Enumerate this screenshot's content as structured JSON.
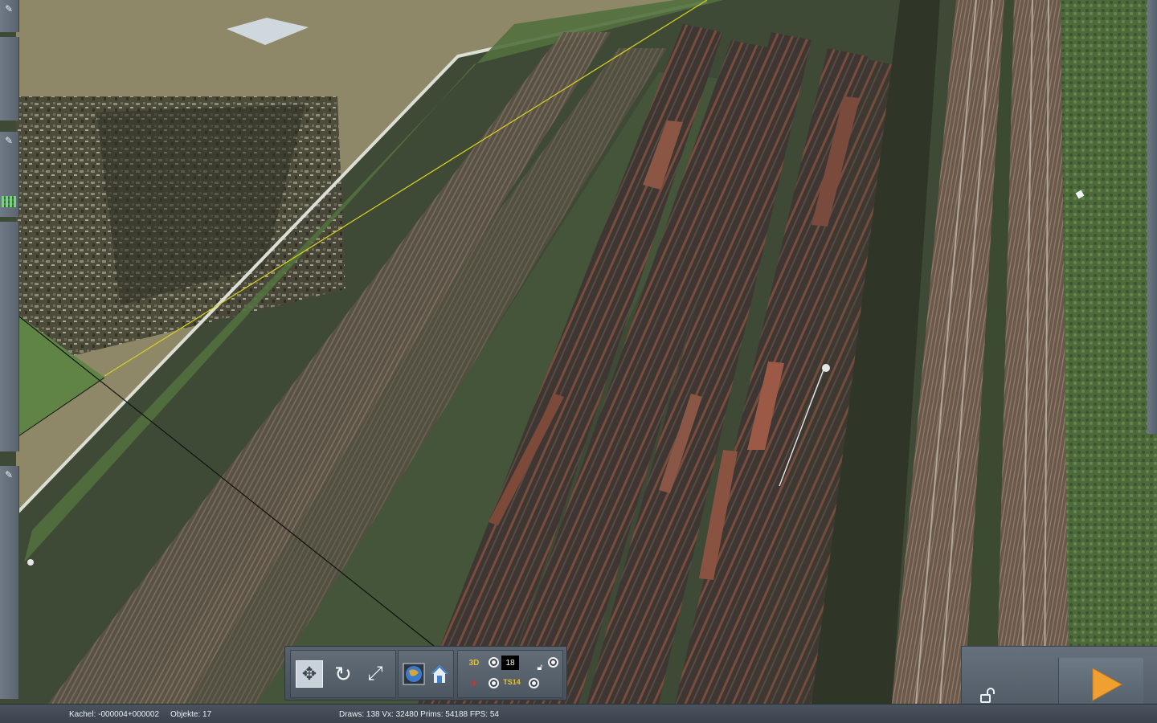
{
  "scene": {
    "description_free": true,
    "colors": {
      "ground_light": "#8f8a6a",
      "scrap_dark": "#3e4032",
      "grass": "#5c7a48",
      "track_bed": "#6b5e4e",
      "rail": "#9a8f84",
      "wagon_rust": "#7a4a3a",
      "wagon_dark": "#3a3430",
      "wall_white": "#d9dcd4",
      "guide_line": "#d8d020"
    }
  },
  "toolbar": {
    "expand_icon": "expand-arrows-icon",
    "rotate_icon": "rotate-icon",
    "resize_icon": "resize-arrows-icon",
    "globe_icon": "globe-icon",
    "home_icon": "home-icon",
    "layer_3d_label": "3D",
    "counter_value": "18",
    "ts_label": "TS14"
  },
  "play_panel": {
    "lock_icon": "unlock-icon",
    "play_icon": "play-icon",
    "play_color": "#f0a030"
  },
  "status": {
    "kachel": "Kachel: -000004+000002",
    "objekte": "Objekte: 17",
    "stats": "Draws: 138 Vx: 32480 Prims: 54188 FPS: 54"
  }
}
